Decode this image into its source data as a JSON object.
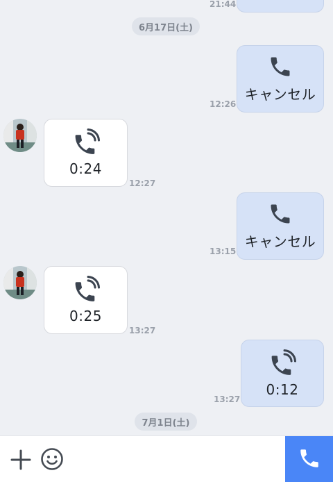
{
  "messages": [
    {
      "id": "m0",
      "time": "21:44"
    },
    {
      "id": "m1",
      "label": "キャンセル",
      "time": "12:26"
    },
    {
      "id": "m2",
      "label": "0:24",
      "time": "12:27"
    },
    {
      "id": "m3",
      "label": "キャンセル",
      "time": "13:15"
    },
    {
      "id": "m4",
      "label": "0:25",
      "time": "13:27"
    },
    {
      "id": "m5",
      "label": "0:12",
      "time": "13:27"
    }
  ],
  "dates": {
    "first": "6月17日(土)",
    "second": "7月1日(土)"
  },
  "icons": {
    "cancelled_call": "phone-icon",
    "completed_call": "phone-ringing-icon",
    "add": "plus-icon",
    "emoji": "smiley-icon",
    "call_button": "phone-icon"
  },
  "colors": {
    "background": "#eef0f4",
    "outgoing_bubble": "#d6e2f7",
    "incoming_bubble": "#ffffff",
    "call_button": "#4a86f7",
    "icon": "#3c4450"
  }
}
